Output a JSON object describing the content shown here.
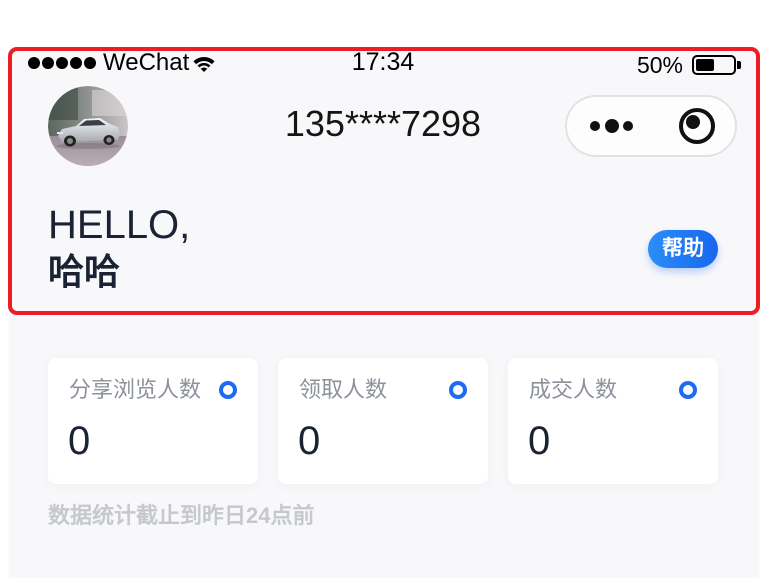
{
  "status_bar": {
    "signal_bars": 5,
    "carrier": "WeChat",
    "time": "17:34",
    "battery_text": "50%",
    "battery_level": 0.5
  },
  "header": {
    "phone": "135****7298",
    "greeting": "HELLO,",
    "user_name": "哈哈",
    "help_label": "帮助"
  },
  "stats": [
    {
      "label": "分享浏览人数",
      "value": "0"
    },
    {
      "label": "领取人数",
      "value": "0"
    },
    {
      "label": "成交人数",
      "value": "0"
    }
  ],
  "footnote": "数据统计截止到昨日24点前",
  "icons": {
    "signal": "signal-icon",
    "wifi": "wifi-icon",
    "battery": "battery-icon",
    "avatar": "avatar-car-photo",
    "more": "more-dots-icon",
    "close": "target-circle-icon",
    "stat": "ring-icon"
  },
  "colors": {
    "accent": "#1d6af5",
    "help_start": "#2b8ef8",
    "help_end": "#1766ee",
    "text_dark": "#1b2234",
    "text_muted": "#8c919a",
    "footnote": "#c5c8ce",
    "frame": "#ee1c25"
  }
}
